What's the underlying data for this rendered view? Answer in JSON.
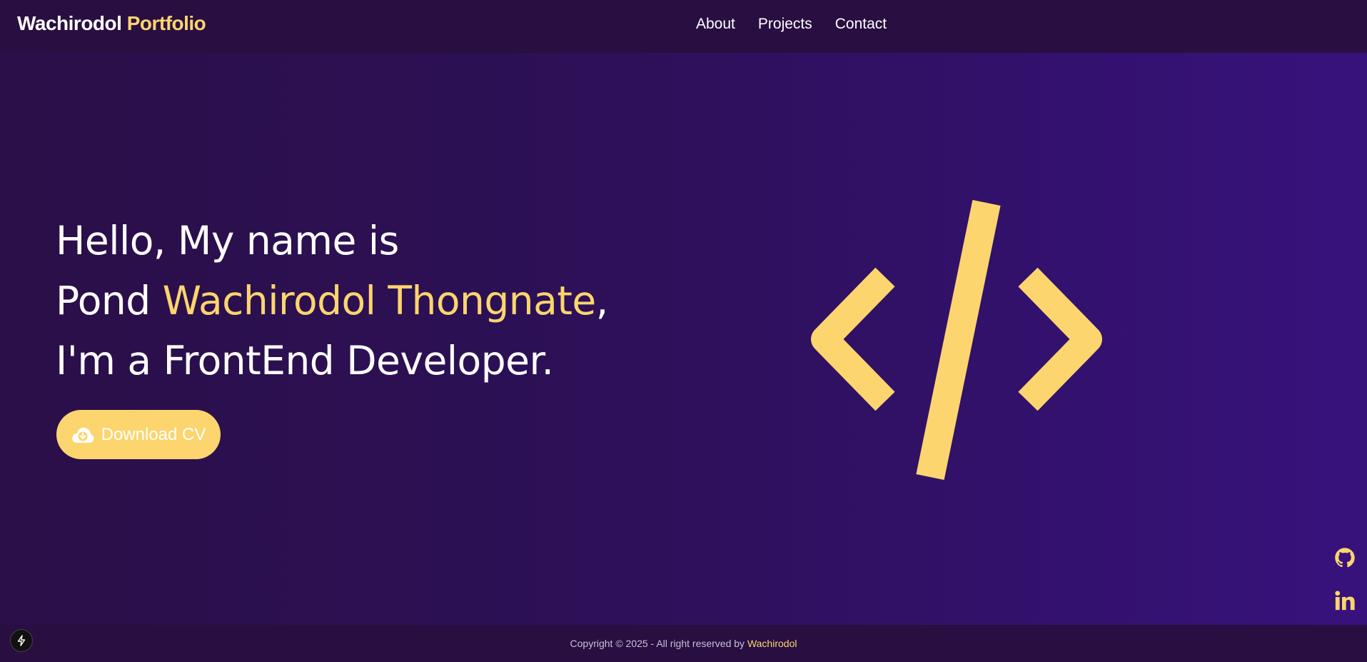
{
  "brand": {
    "name": "Wachirodol",
    "accent": "Portfolio"
  },
  "nav": {
    "items": [
      "About",
      "Projects",
      "Contact"
    ]
  },
  "hero": {
    "line1": "Hello, My name is",
    "line2_prefix": "Pond ",
    "line2_name": "Wachirodol Thongnate",
    "line2_suffix": ",",
    "line3": "I'm a FrontEnd Developer.",
    "button_label": "Download CV",
    "button_icon": "cloud-download-icon",
    "illustration_icon": "code-brackets-icon"
  },
  "social": {
    "icons": [
      "github-icon",
      "linkedin-icon"
    ]
  },
  "footer": {
    "text": "Copyright © 2025 - All right reserved by ",
    "owner": "Wachirodol"
  },
  "colors": {
    "accent": "#fcd56e",
    "bar": "#290e42",
    "bg_start": "#2a0f48",
    "bg_end": "#37127c"
  }
}
